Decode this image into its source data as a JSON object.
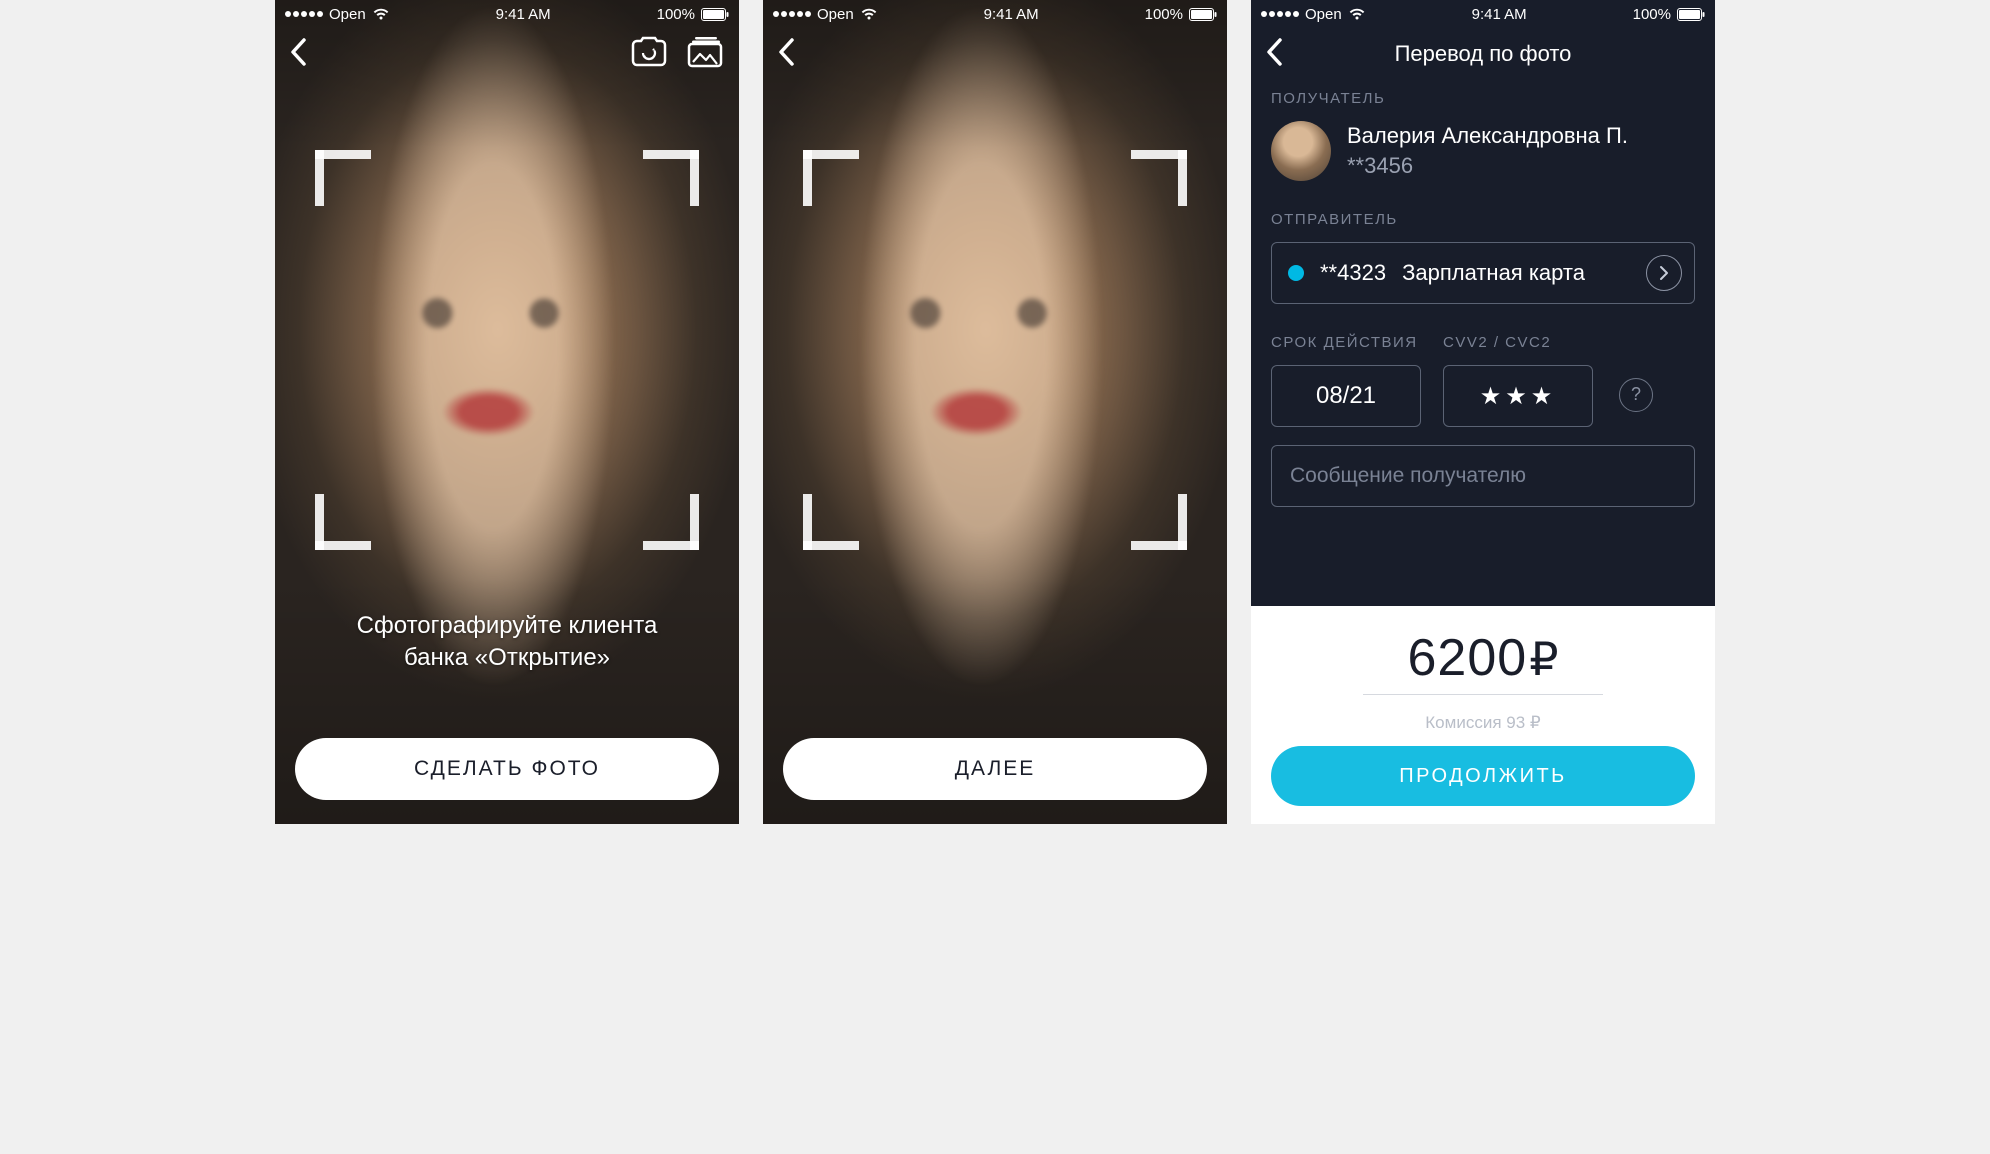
{
  "status": {
    "carrier": "Open",
    "time": "9:41 AM",
    "battery": "100%"
  },
  "screens": {
    "camera": {
      "instruction_line1": "Сфотографируйте клиента",
      "instruction_line2": "банка «Открытие»",
      "button": "СДЕЛАТЬ ФОТО"
    },
    "confirm": {
      "button": "ДАЛЕЕ"
    },
    "transfer": {
      "title": "Перевод по фото",
      "recipient_label": "ПОЛУЧАТЕЛЬ",
      "recipient_name": "Валерия Александровна П.",
      "recipient_card": "**3456",
      "sender_label": "ОТПРАВИТЕЛЬ",
      "sender_mask": "**4323",
      "sender_card_name": "Зарплатная карта",
      "expiry_label": "СРОК ДЕЙСТВИЯ",
      "expiry_value": "08/21",
      "cvv_label": "CVV2 / CVC2",
      "cvv_value": "★★★",
      "message_placeholder": "Сообщение получателю",
      "amount": "6200",
      "currency": "₽",
      "commission": "Комиссия 93 ₽",
      "button": "ПРОДОЛЖИТЬ"
    }
  }
}
